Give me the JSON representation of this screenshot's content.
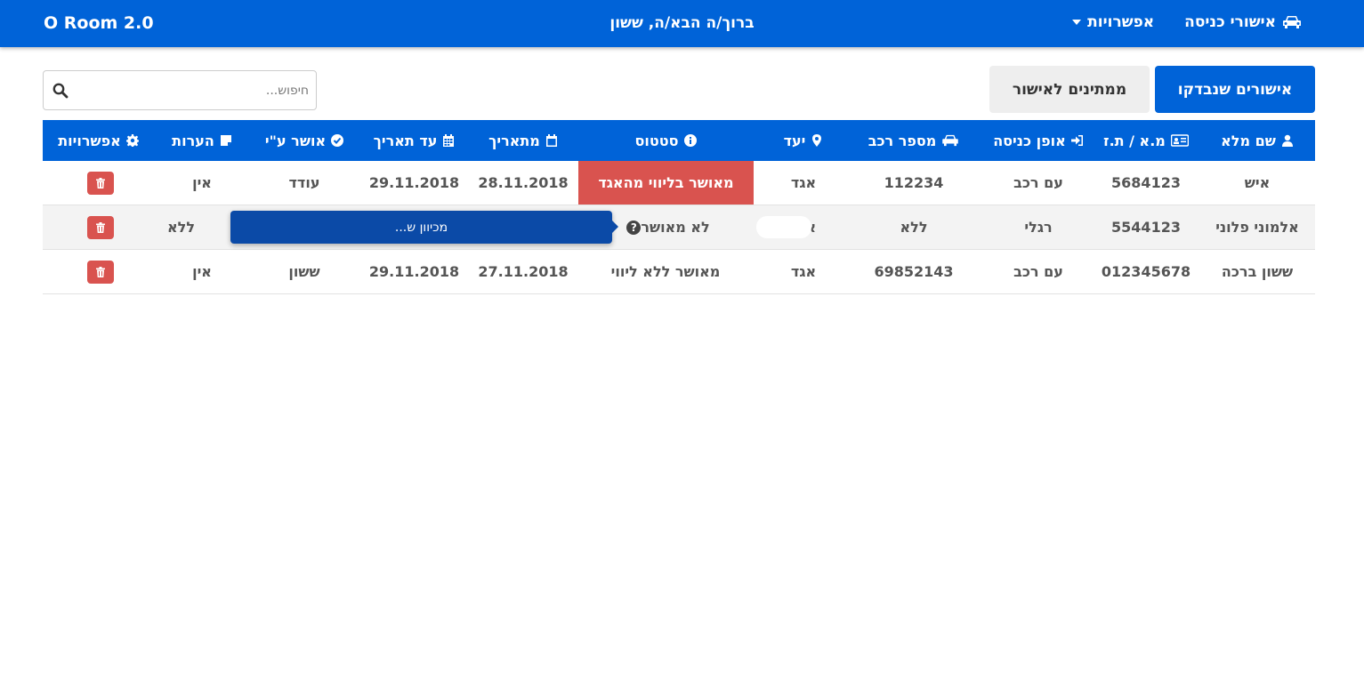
{
  "navbar": {
    "brand": "O Room 2.0",
    "welcome": "ברוך/ה הבא/ה, ששון",
    "items": [
      {
        "label": "אישורי כניסה",
        "icon": "car-icon"
      },
      {
        "label": "אפשרויות",
        "icon": "caret-down-icon"
      }
    ]
  },
  "tabs": {
    "checked": "אישורים שנבדקו",
    "pending": "ממתינים לאישור"
  },
  "search": {
    "placeholder": "חיפוש..."
  },
  "table": {
    "headers": [
      {
        "label": "שם מלא",
        "icon": "user-icon"
      },
      {
        "label": "מ.א / ת.ז",
        "icon": "id-card-icon"
      },
      {
        "label": "אופן כניסה",
        "icon": "sign-in-icon"
      },
      {
        "label": "מספר רכב",
        "icon": "car-icon"
      },
      {
        "label": "יעד",
        "icon": "map-marker-icon"
      },
      {
        "label": "סטטוס",
        "icon": "info-icon"
      },
      {
        "label": "מתאריך",
        "icon": "calendar-icon"
      },
      {
        "label": "עד תאריך",
        "icon": "calendar-grid-icon"
      },
      {
        "label": "אושר ע\"י",
        "icon": "check-circle-icon"
      },
      {
        "label": "הערות",
        "icon": "note-icon"
      },
      {
        "label": "אפשרויות",
        "icon": "gear-icon"
      }
    ],
    "rows": [
      {
        "name": "איש",
        "id": "5684123",
        "entry": "עם רכב",
        "car": "112234",
        "dest": "אגד",
        "status": "מאושר בליווי מהאגד",
        "from": "28.11.2018",
        "to": "29.11.2018",
        "approved_by": "עודד",
        "notes": "אין"
      },
      {
        "name": "אלמוני פלוני",
        "id": "5544123",
        "entry": "רגלי",
        "car": "ללא",
        "dest": "אגד",
        "status": "לא מאושר",
        "from": "",
        "to": "",
        "approved_by": "",
        "notes": "ללא"
      },
      {
        "name": "ששון ברכה",
        "id": "012345678",
        "entry": "עם רכב",
        "car": "69852143",
        "dest": "אגד",
        "status": "מאושר ללא ליווי",
        "from": "27.11.2018",
        "to": "29.11.2018",
        "approved_by": "ששון",
        "notes": "אין"
      }
    ]
  },
  "tooltip": {
    "text": "מכיוון ש..."
  },
  "colors": {
    "primary": "#0063d8",
    "danger": "#d9534f",
    "tooltip": "#0b4aa7"
  }
}
